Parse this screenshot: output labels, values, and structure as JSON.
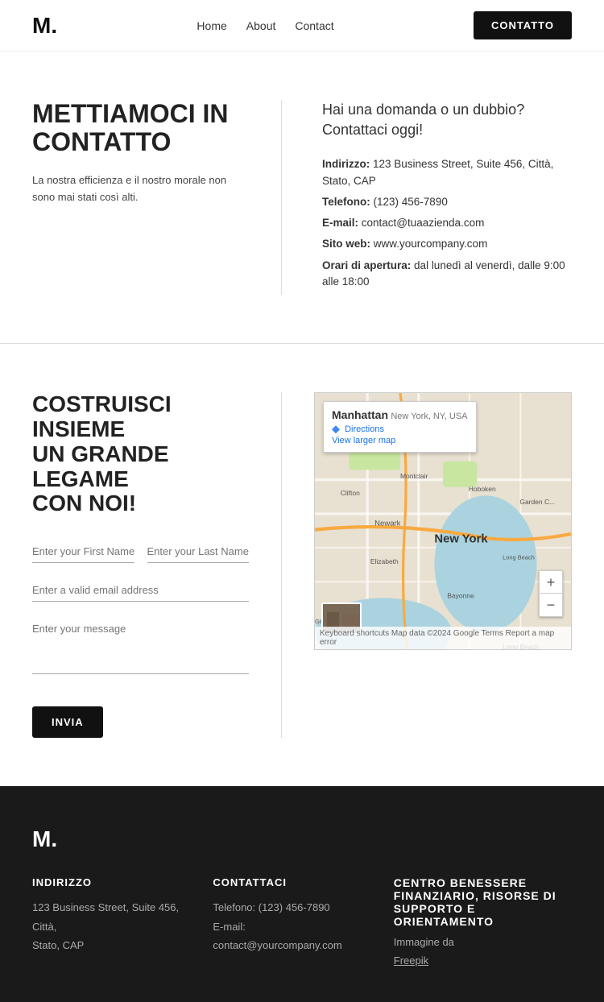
{
  "header": {
    "logo": "M.",
    "nav": {
      "home": "Home",
      "about": "About",
      "contact": "Contact"
    },
    "cta_label": "CONTATTO"
  },
  "section1": {
    "left": {
      "title": "METTIAMOCI IN CONTATTO",
      "subtitle": "La nostra efficienza e il nostro morale non sono mai stati così alti."
    },
    "right": {
      "heading_line1": "Hai una domanda o un dubbio?",
      "heading_line2": "Contattaci oggi!",
      "address_label": "Indirizzo:",
      "address_value": "123 Business Street, Suite 456, Città, Stato, CAP",
      "phone_label": "Telefono:",
      "phone_value": "(123) 456-7890",
      "email_label": "E-mail:",
      "email_value": "contact@tuaazienda.com",
      "website_label": "Sito web:",
      "website_value": "www.yourcompany.com",
      "hours_label": "Orari di apertura:",
      "hours_value": "dal lunedì al venerdì, dalle 9:00 alle 18:00"
    }
  },
  "section2": {
    "left": {
      "title_line1": "COSTRUISCI INSIEME",
      "title_line2": "UN GRANDE LEGAME",
      "title_line3": "CON NOI!",
      "first_name_placeholder": "Enter your First Name",
      "last_name_placeholder": "Enter your Last Name",
      "email_placeholder": "Enter a valid email address",
      "message_placeholder": "Enter your message",
      "submit_label": "INVIA"
    },
    "right": {
      "map_location": "Manhattan",
      "map_subloc": "New York, NY, USA",
      "directions_label": "Directions",
      "view_larger_label": "View larger map",
      "zoom_in": "+",
      "zoom_out": "−",
      "map_footer": "Keyboard shortcuts  Map data ©2024 Google  Terms  Report a map error"
    }
  },
  "footer": {
    "logo": "M.",
    "col1": {
      "heading": "INDIRIZZO",
      "line1": "123 Business Street, Suite 456, Città,",
      "line2": "Stato, CAP"
    },
    "col2": {
      "heading": "CONTATTACI",
      "phone": "Telefono: (123) 456-7890",
      "email": "E-mail: contact@yourcompany.com"
    },
    "col3": {
      "heading": "Centro benessere finanziario, risorse di supporto e orientamento",
      "credit_prefix": "Immagine da ",
      "credit_link": "Freepik"
    }
  }
}
